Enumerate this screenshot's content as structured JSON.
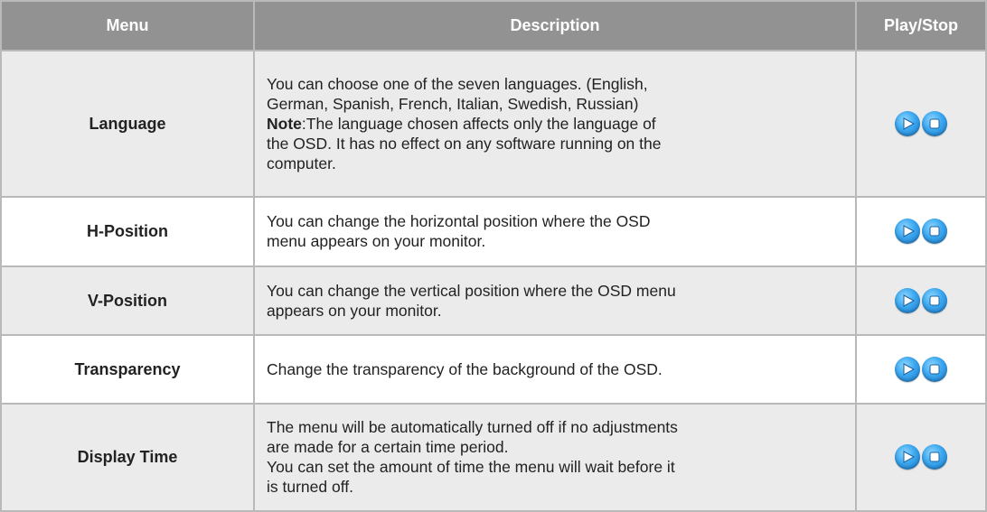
{
  "header": {
    "menu": "Menu",
    "description": "Description",
    "play_stop": "Play/Stop"
  },
  "rows": [
    {
      "menu": "Language",
      "lines": [
        "You can choose one of the seven languages. (English,",
        "German, Spanish, French, Italian, Swedish, Russian)"
      ],
      "note_label": "Note",
      "note_text": ":The language chosen affects only the language of",
      "note_lines": [
        "the OSD. It has no effect on any software running on the",
        "computer."
      ]
    },
    {
      "menu": "H-Position",
      "lines": [
        "You can change the horizontal position where the OSD",
        "menu appears on your monitor."
      ]
    },
    {
      "menu": "V-Position",
      "lines": [
        "You can change the vertical position where the OSD menu",
        "appears on your monitor."
      ]
    },
    {
      "menu": "Transparency",
      "lines": [
        "Change the transparency of the background of the OSD."
      ]
    },
    {
      "menu": "Display Time",
      "lines": [
        "The menu will be automatically turned off if no adjustments",
        "are made for a certain time period.",
        "You can set the amount of time the menu will wait before it",
        "is turned off."
      ]
    }
  ],
  "icons": {
    "play": "play-icon",
    "stop": "stop-icon"
  },
  "colors": {
    "header_bg": "#929292",
    "odd_row_bg": "#ebebeb",
    "even_row_bg": "#ffffff",
    "button_blue": "#3aa7ef"
  }
}
